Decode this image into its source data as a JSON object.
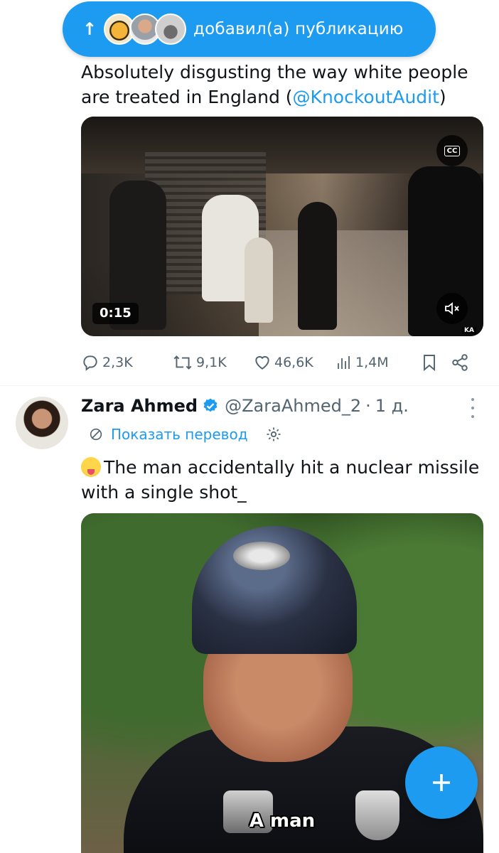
{
  "toast": {
    "label": "добавил(а) публикацию",
    "icon": "arrow-up-icon"
  },
  "tweet1": {
    "text_before": "Absolutely disgusting the way white people are treated in England (",
    "mention": "@KnockoutAudit",
    "text_after": ")",
    "video": {
      "duration": "0:15",
      "cc_label": "CC",
      "watermark": "KA"
    },
    "stats": {
      "replies": "2,3K",
      "retweets": "9,1K",
      "likes": "46,6K",
      "views": "1,4M"
    }
  },
  "tweet2": {
    "name": "Zara Ahmed",
    "handle": "@ZaraAhmed_2",
    "separator": "·",
    "time": "1 д.",
    "translate_label": "Показать перевод",
    "text": "The man accidentally hit a nuclear missile with a single shot_",
    "subtitle": "A man"
  },
  "colors": {
    "accent": "#1d9bf0",
    "text": "#0f1419",
    "muted": "#536471"
  }
}
